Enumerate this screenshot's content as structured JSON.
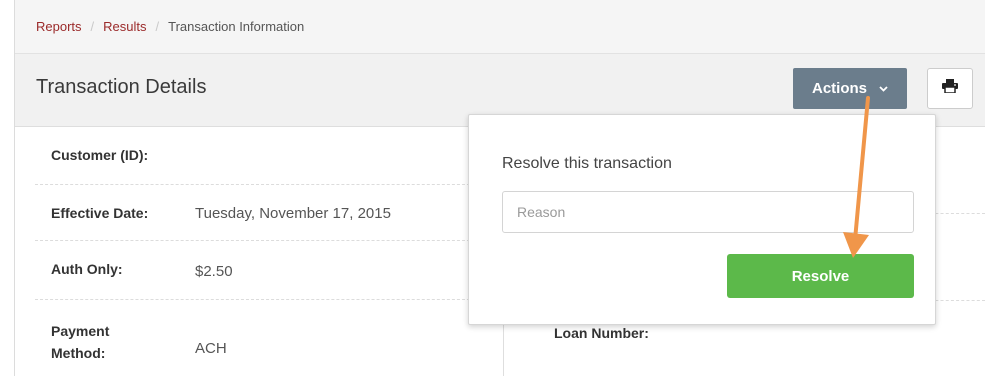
{
  "breadcrumb": {
    "items": [
      "Reports",
      "Results",
      "Transaction Information"
    ],
    "separator": "/"
  },
  "header": {
    "title": "Transaction Details",
    "actions_label": "Actions",
    "actions_icon": "chevron-down-icon",
    "print_icon": "printer-icon"
  },
  "details": [
    {
      "label": "Customer (ID):",
      "value": ""
    },
    {
      "label": "Effective Date:",
      "value": "Tuesday, November 17, 2015"
    },
    {
      "label": "Auth Only:",
      "value": "$2.50"
    },
    {
      "label": "Payment Method:",
      "value": "ACH"
    }
  ],
  "right_fields": {
    "loan_number_label": "Loan Number:"
  },
  "popover": {
    "title": "Resolve this transaction",
    "reason_placeholder": "Reason",
    "reason_value": "",
    "resolve_label": "Resolve"
  },
  "colors": {
    "link": "#9b2a2a",
    "actions_bg": "#6b7d8c",
    "resolve_bg": "#5cb94a",
    "annotation_arrow": "#f0964a"
  }
}
